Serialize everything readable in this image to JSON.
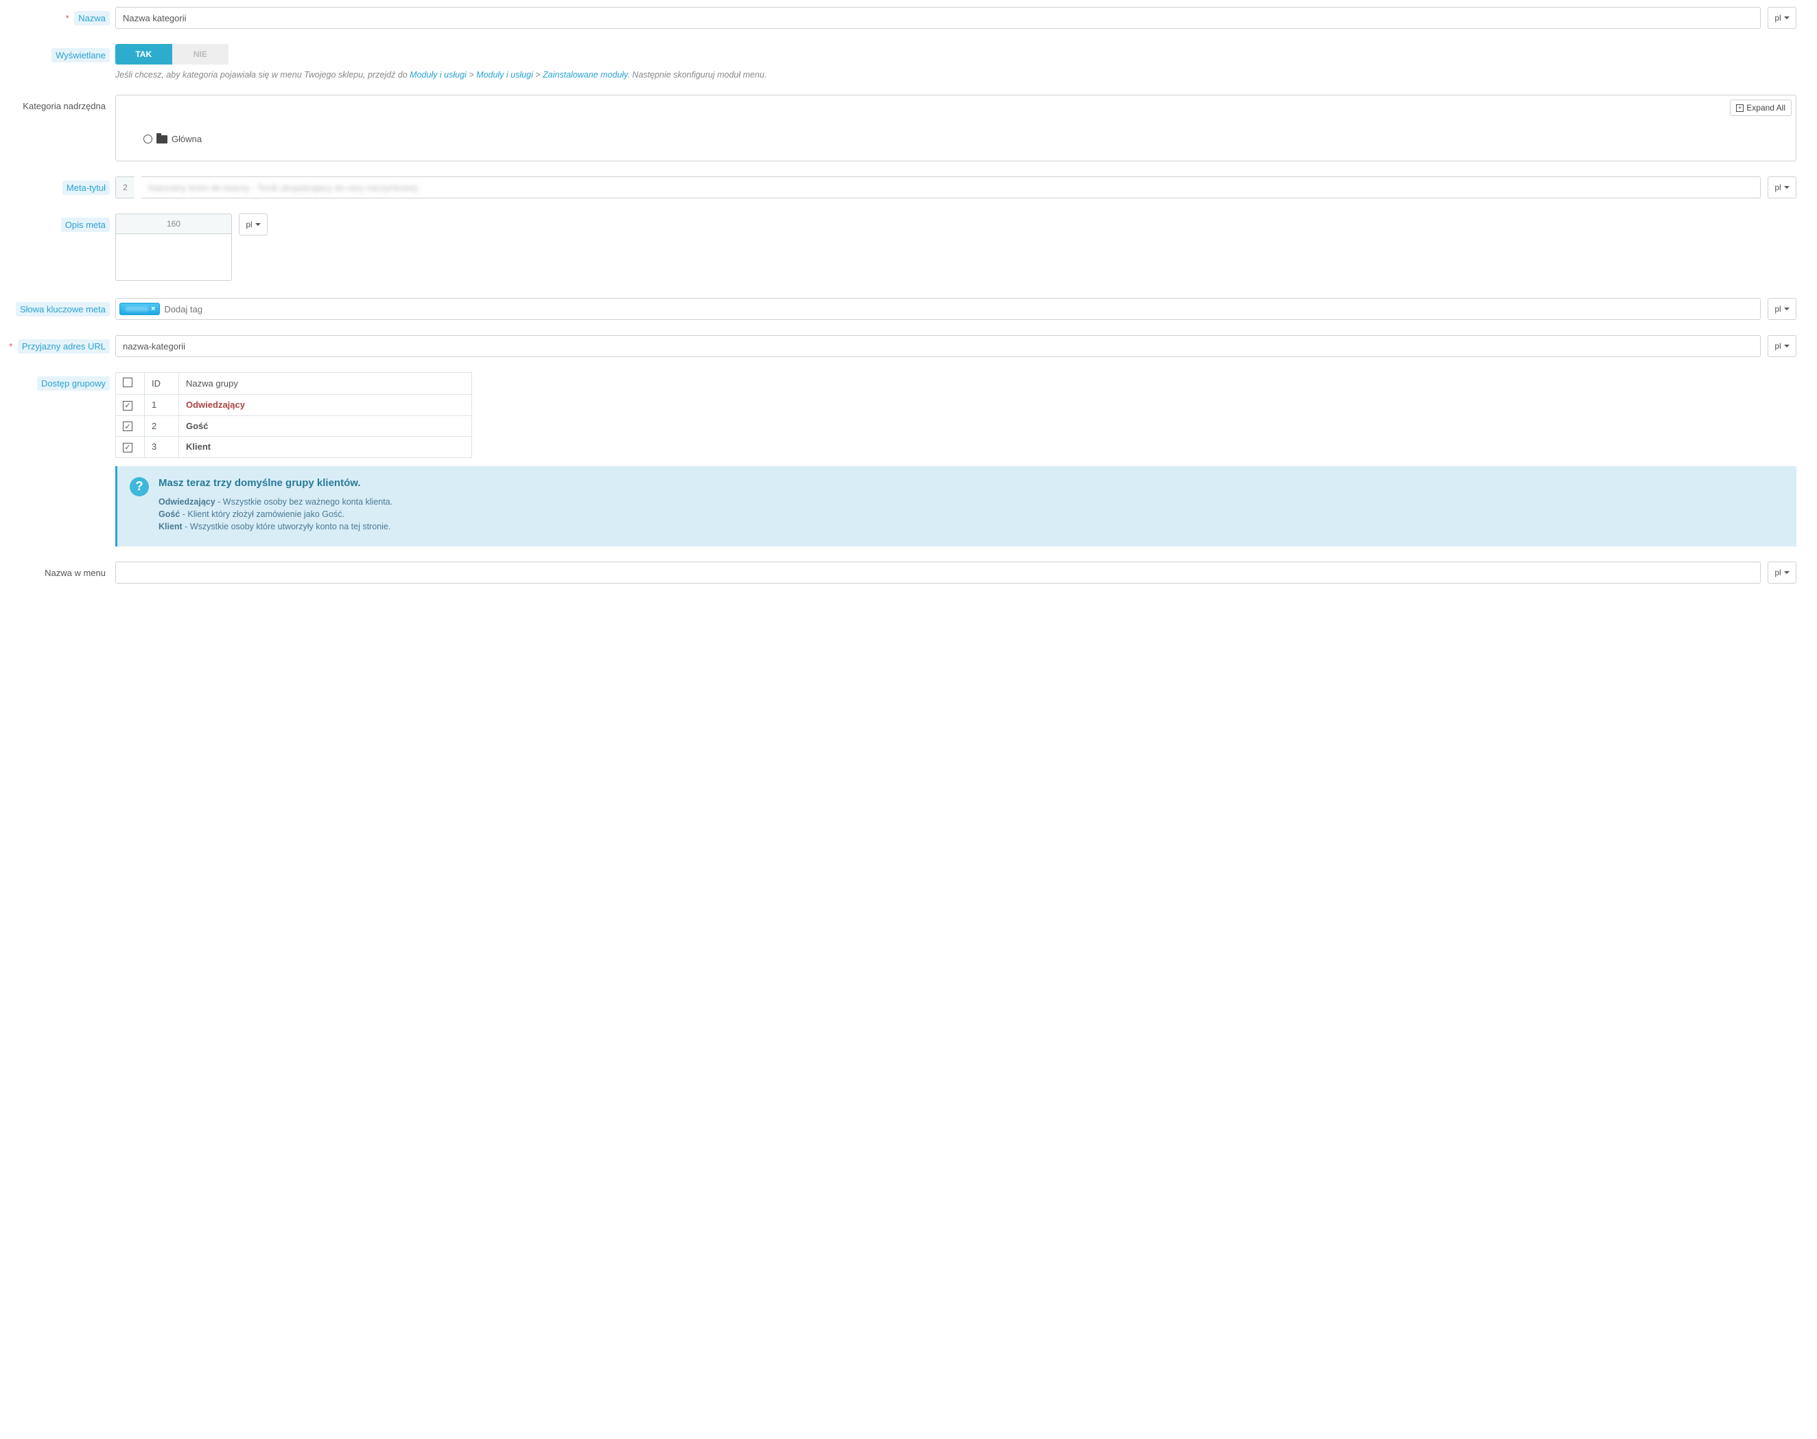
{
  "lang": "pl",
  "labels": {
    "name": "Nazwa",
    "displayed": "Wyświetlane",
    "parent_category": "Kategoria nadrzędna",
    "meta_title": "Meta-tytuł",
    "meta_description": "Opis meta",
    "meta_keywords": "Słowa kluczowe meta",
    "friendly_url": "Przyjazny adres URL",
    "group_access": "Dostęp grupowy",
    "menu_name": "Nazwa w menu"
  },
  "name_value": "Nazwa kategorii",
  "toggle": {
    "yes": "TAK",
    "no": "NIE"
  },
  "displayed_help_prefix": "Jeśli chcesz, aby kategoria pojawiała się w menu Twojego sklepu, przejdź do ",
  "displayed_help_links": [
    "Moduły i usługi",
    "Moduły i usługi",
    "Zainstalowane moduły"
  ],
  "displayed_help_suffix": ". Następnie skonfiguruj moduł menu.",
  "expand_all": "Expand All",
  "tree_root": "Główna",
  "meta_title": {
    "counter": "2",
    "value": ""
  },
  "meta_description": {
    "counter": "160",
    "value": ""
  },
  "meta_keywords": {
    "tag": "",
    "placeholder": "Dodaj tag"
  },
  "friendly_url_value": "nazwa-kategorii",
  "group_table": {
    "id_header": "ID",
    "name_header": "Nazwa grupy",
    "rows": [
      {
        "id": "1",
        "name": "Odwiedzający",
        "checked": true
      },
      {
        "id": "2",
        "name": "Gość",
        "checked": true
      },
      {
        "id": "3",
        "name": "Klient",
        "checked": true
      }
    ]
  },
  "info": {
    "title": "Masz teraz trzy domyślne grupy klientów.",
    "lines": [
      {
        "b": "Odwiedzający",
        "t": " - Wszystkie osoby bez ważnego konta klienta."
      },
      {
        "b": "Gość",
        "t": " - Klient który złożył zamówienie jako Gość."
      },
      {
        "b": "Klient",
        "t": " - Wszystkie osoby które utworzyły konto na tej stronie."
      }
    ]
  },
  "menu_name_value": ""
}
